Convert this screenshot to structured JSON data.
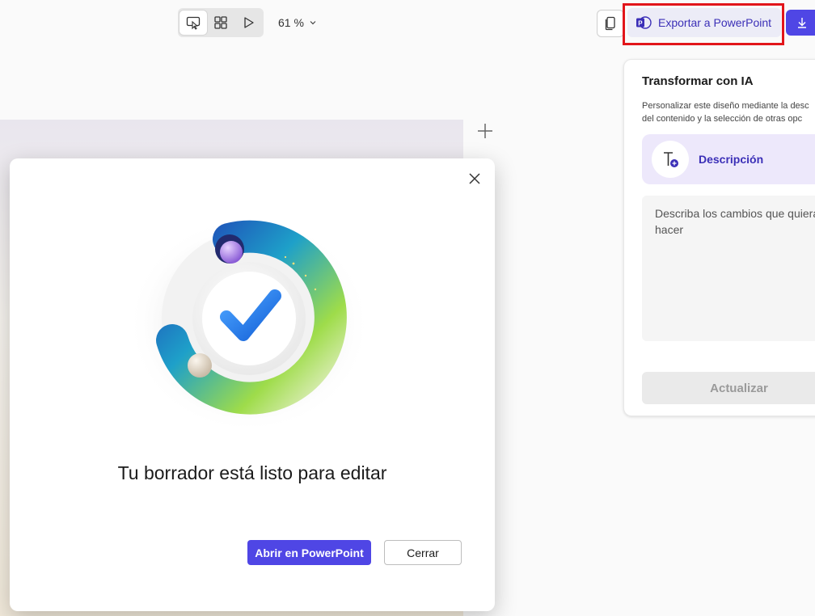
{
  "toolbar": {
    "zoom_label": "61 %",
    "export_label": "Exportar a PowerPoint"
  },
  "ai_panel": {
    "title": "Transformar con IA",
    "description_line1": "Personalizar este diseño mediante la desc",
    "description_line2": "del contenido y la selección de otras opc",
    "option_label": "Descripción",
    "textarea_placeholder": "Describa los cambios que quiera hacer",
    "update_label": "Actualizar"
  },
  "dialog": {
    "title": "Tu borrador está listo para editar",
    "primary_label": "Abrir en PowerPoint",
    "secondary_label": "Cerrar"
  },
  "colors": {
    "accent": "#4f46e5",
    "accent_text": "#3b2fb7",
    "highlight": "#e2151a"
  },
  "icons": [
    "select-icon",
    "grid-icon",
    "play-icon",
    "chevron-down-icon",
    "copy-icon",
    "powerpoint-icon",
    "download-icon",
    "plus-icon",
    "text-ai-icon",
    "close-icon",
    "checkmark-illustration"
  ]
}
